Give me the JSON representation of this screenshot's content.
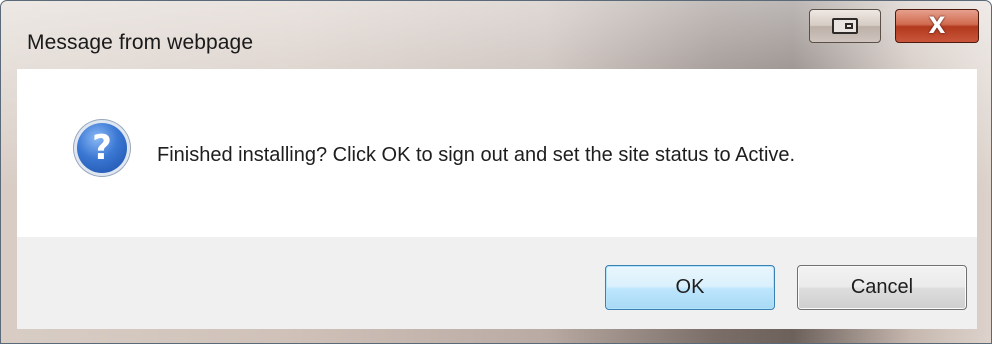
{
  "window": {
    "title": "Message from webpage",
    "close_label": "X"
  },
  "message": {
    "icon": "question-icon",
    "icon_glyph": "?",
    "text": "Finished installing? Click OK to sign out and set the site status to Active."
  },
  "buttons": {
    "ok_label": "OK",
    "cancel_label": "Cancel"
  },
  "colors": {
    "content_bg": "#ffffff",
    "footer_bg": "#f0f0f0",
    "close_button": "#c9553a",
    "default_button_border": "#3c7fb1"
  }
}
